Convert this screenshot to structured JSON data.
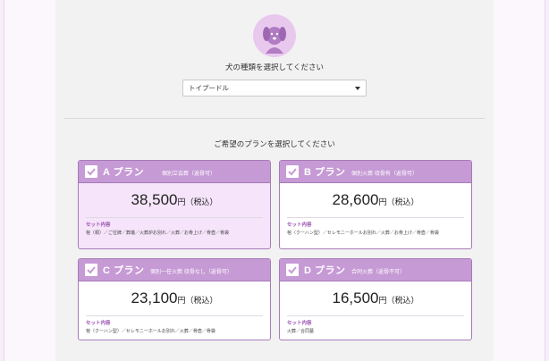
{
  "breed_section": {
    "icon": "dog-face-icon",
    "title": "犬の種類を選択してください",
    "selected": "トイプードル"
  },
  "plan_section": {
    "title": "ご希望のプランを選択してください"
  },
  "colors": {
    "accent": "#c69ad5",
    "border": "#a77bb8",
    "selected_bg": "#f6e4fa",
    "set_label": "#9a4fb0"
  },
  "plans": [
    {
      "name": "A プラン",
      "desc": "個別立会葬（返骨可）",
      "price": "38,500",
      "unit": "円（税込）",
      "set_label": "セット内容",
      "items": "棺（桐）／ご位牌／葬儀／火葬炉お別れ／火葬／お骨上げ／骨壺／骨袋",
      "selected": true
    },
    {
      "name": "B プラン",
      "desc": "個別火葬 収骨有（返骨可）",
      "price": "28,600",
      "unit": "円（税込）",
      "set_label": "セット内容",
      "items": "棺（クーハン型）／セレモニーホールお別れ／火葬／お骨上げ／骨壺／骨袋",
      "selected": false
    },
    {
      "name": "C プラン",
      "desc": "個別一任火葬 収骨なし（返骨可）",
      "price": "23,100",
      "unit": "円（税込）",
      "set_label": "セット内容",
      "items": "棺（クーハン型）／セレモニーホールお別れ／火葬／骨壺／骨袋",
      "selected": false
    },
    {
      "name": "D プラン",
      "desc": "合同火葬（返骨不可）",
      "price": "16,500",
      "unit": "円（税込）",
      "set_label": "セット内容",
      "items": "火葬／合同墓",
      "selected": false
    }
  ]
}
